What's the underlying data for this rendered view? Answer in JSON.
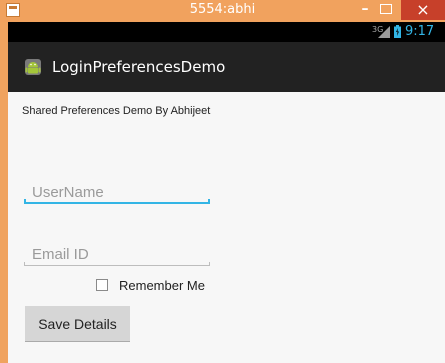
{
  "window": {
    "title": "5554:abhi",
    "minimize_label": "–",
    "close_label": "×",
    "accent_color": "#f1a25e",
    "close_color": "#c7402a"
  },
  "status_bar": {
    "network": "3G",
    "time": "9:17",
    "time_color": "#33b5e5"
  },
  "action_bar": {
    "app_icon": "android-icon",
    "title": "LoginPreferencesDemo",
    "background": "#222222"
  },
  "content": {
    "heading": "Shared Preferences Demo By Abhijeet",
    "username_placeholder": "UserName",
    "email_placeholder": "Email ID",
    "remember_label": "Remember Me",
    "remember_checked": false,
    "save_button": "Save Details",
    "focus_color": "#33b5e5"
  }
}
